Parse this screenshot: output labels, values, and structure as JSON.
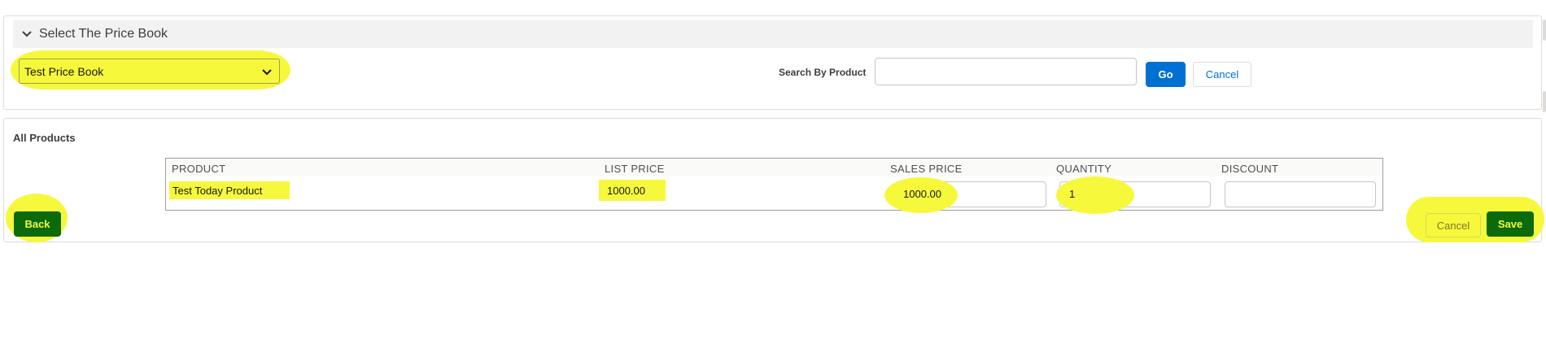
{
  "price_book_section": {
    "title": "Select The Price Book",
    "selected_price_book": "Test Price Book",
    "search_label": "Search By Product",
    "search_value": "",
    "go_label": "Go",
    "cancel_label": "Cancel"
  },
  "products_section": {
    "title": "All Products",
    "columns": [
      "PRODUCT",
      "LIST PRICE",
      "SALES PRICE",
      "QUANTITY",
      "DISCOUNT"
    ],
    "rows": [
      {
        "product": "Test Today Product",
        "list_price": "1000.00",
        "sales_price": "1000.00",
        "quantity": "1",
        "discount": ""
      }
    ],
    "back_label": "Back",
    "cancel_label": "Cancel",
    "save_label": "Save"
  },
  "colors": {
    "highlight": "#f6f83c",
    "primary_blue": "#0070d2",
    "save_green": "#0b6b0b"
  }
}
